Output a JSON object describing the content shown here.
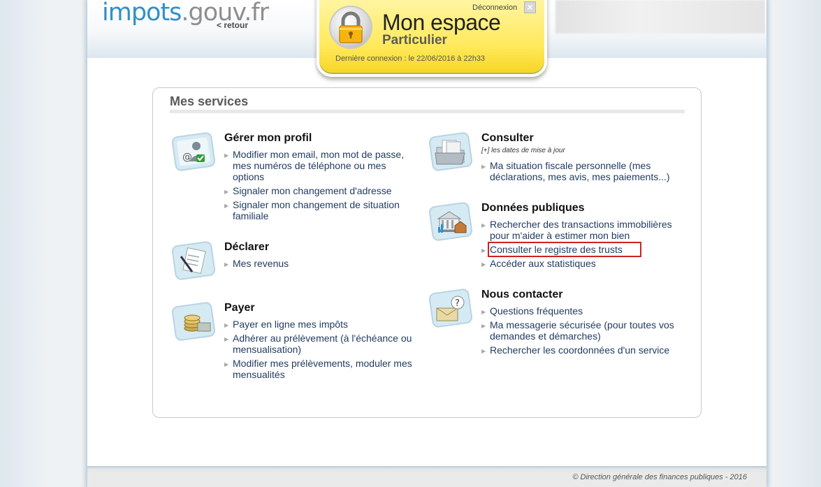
{
  "header": {
    "logo_left": "impots",
    "logo_right": ".gouv.fr",
    "retour": "< retour"
  },
  "espace": {
    "deconnexion": "Déconnexion",
    "close": "×",
    "title": "Mon espace",
    "subtitle": "Particulier",
    "last_login": "Dernière connexion : le 22/06/2016 à 22h33"
  },
  "services": {
    "title": "Mes services",
    "profil": {
      "title": "Gérer mon profil",
      "items": [
        "Modifier mon email, mon mot de passe, mes numéros de téléphone ou mes options",
        "Signaler mon changement d'adresse",
        "Signaler mon changement de situation familiale"
      ]
    },
    "declarer": {
      "title": "Déclarer",
      "items": [
        "Mes revenus"
      ]
    },
    "payer": {
      "title": "Payer",
      "items": [
        "Payer en ligne mes impôts",
        "Adhérer au prélèvement (à l'échéance ou mensualisation)",
        "Modifier mes prélèvements, moduler mes mensualités"
      ]
    },
    "consulter": {
      "title": "Consulter",
      "hint": "[+] les dates de mise à jour",
      "items": [
        "Ma situation fiscale personnelle (mes déclarations, mes avis, mes paiements...)"
      ]
    },
    "donnees": {
      "title": "Données publiques",
      "items": [
        "Rechercher des transactions immobilières pour m'aider à estimer mon bien",
        "Consulter le registre des trusts",
        "Accéder aux statistiques"
      ]
    },
    "contact": {
      "title": "Nous contacter",
      "items": [
        "Questions fréquentes",
        "Ma messagerie sécurisée (pour toutes vos demandes et démarches)",
        "Rechercher les coordonnées d'un service"
      ]
    }
  },
  "footer": {
    "copyright": "© Direction générale des finances publiques - 2016"
  },
  "colors": {
    "accent": "#2f90c9",
    "yellow": "#ffe95a",
    "highlight": "#cc2222",
    "link": "#1f3a5f"
  },
  "icons": [
    "lock-icon",
    "profile-icon",
    "declare-icon",
    "pay-icon",
    "consult-icon",
    "public-data-icon",
    "contact-icon"
  ]
}
